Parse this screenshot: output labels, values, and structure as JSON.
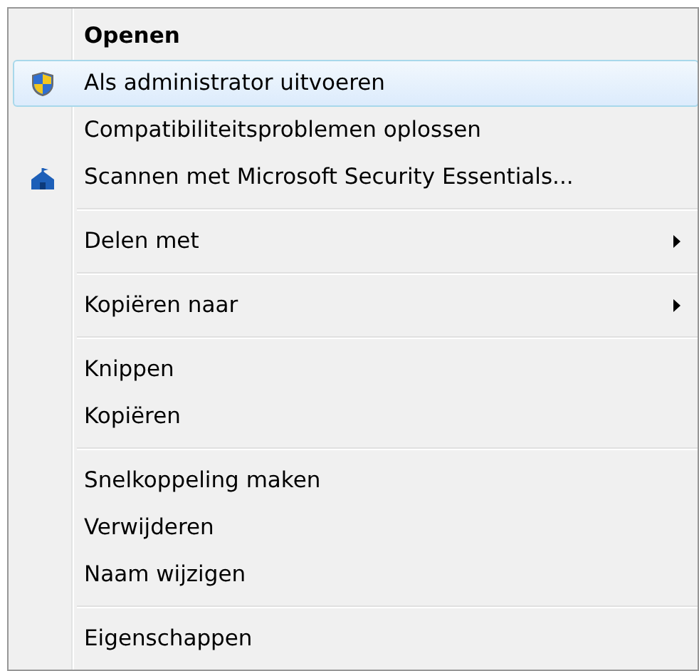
{
  "menu": {
    "items": [
      {
        "kind": "item",
        "label": "Openen",
        "bold": true,
        "selected": false
      },
      {
        "kind": "item",
        "label": "Als administrator uitvoeren",
        "selected": true
      },
      {
        "kind": "item",
        "label": "Compatibiliteitsproblemen oplossen",
        "selected": false
      },
      {
        "kind": "item",
        "label": "Scannen met Microsoft Security Essentials...",
        "selected": false
      },
      {
        "kind": "separator"
      },
      {
        "kind": "item",
        "label": "Delen met",
        "submenu": true,
        "selected": false
      },
      {
        "kind": "separator"
      },
      {
        "kind": "item",
        "label": "Kopiëren naar",
        "submenu": true,
        "selected": false
      },
      {
        "kind": "separator"
      },
      {
        "kind": "item",
        "label": "Knippen",
        "selected": false
      },
      {
        "kind": "item",
        "label": "Kopiëren",
        "selected": false
      },
      {
        "kind": "separator"
      },
      {
        "kind": "item",
        "label": "Snelkoppeling maken",
        "selected": false
      },
      {
        "kind": "item",
        "label": "Verwijderen",
        "selected": false
      },
      {
        "kind": "item",
        "label": "Naam wijzigen",
        "selected": false
      },
      {
        "kind": "separator"
      },
      {
        "kind": "item",
        "label": "Eigenschappen",
        "selected": false
      }
    ]
  }
}
